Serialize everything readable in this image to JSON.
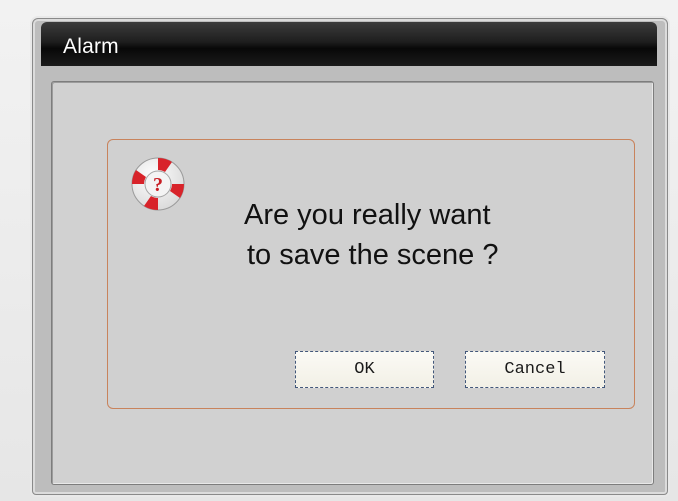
{
  "window": {
    "title": "Alarm"
  },
  "dialog": {
    "icon": "help-lifebuoy-icon",
    "message_line1": "Are you really want",
    "message_line2": "to save the scene ?",
    "ok_label": "OK",
    "cancel_label": "Cancel"
  },
  "colors": {
    "titlebar": "#0b0b0b",
    "panel_border": "#c8835c",
    "background": "#d1d1d1"
  }
}
